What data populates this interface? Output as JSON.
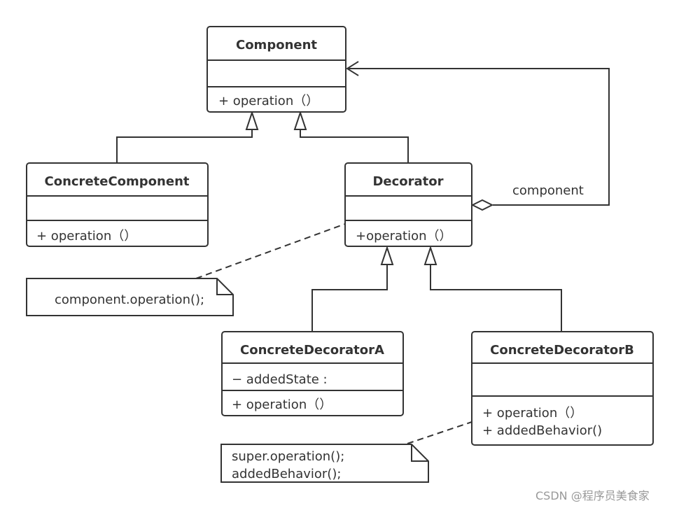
{
  "classes": {
    "component": {
      "name": "Component",
      "operations": [
        "+ operation（）"
      ]
    },
    "concrete_component": {
      "name": "ConcreteComponent",
      "operations": [
        "+ operation（）"
      ]
    },
    "decorator": {
      "name": "Decorator",
      "operations": [
        "+operation（）"
      ]
    },
    "concrete_decorator_a": {
      "name": "ConcreteDecoratorA",
      "attributes": [
        "− addedState :"
      ],
      "operations": [
        "+ operation（）"
      ]
    },
    "concrete_decorator_b": {
      "name": "ConcreteDecoratorB",
      "operations": [
        "+ operation（）",
        "+ addedBehavior()"
      ]
    }
  },
  "associations": {
    "aggregation_label": "component"
  },
  "notes": {
    "decorator_note": [
      "component.operation();"
    ],
    "decorator_b_note": [
      "super.operation();",
      "addedBehavior();"
    ]
  },
  "watermark": "CSDN @程序员美食家",
  "colors": {
    "stroke": "#333333",
    "watermark": "#999999"
  }
}
